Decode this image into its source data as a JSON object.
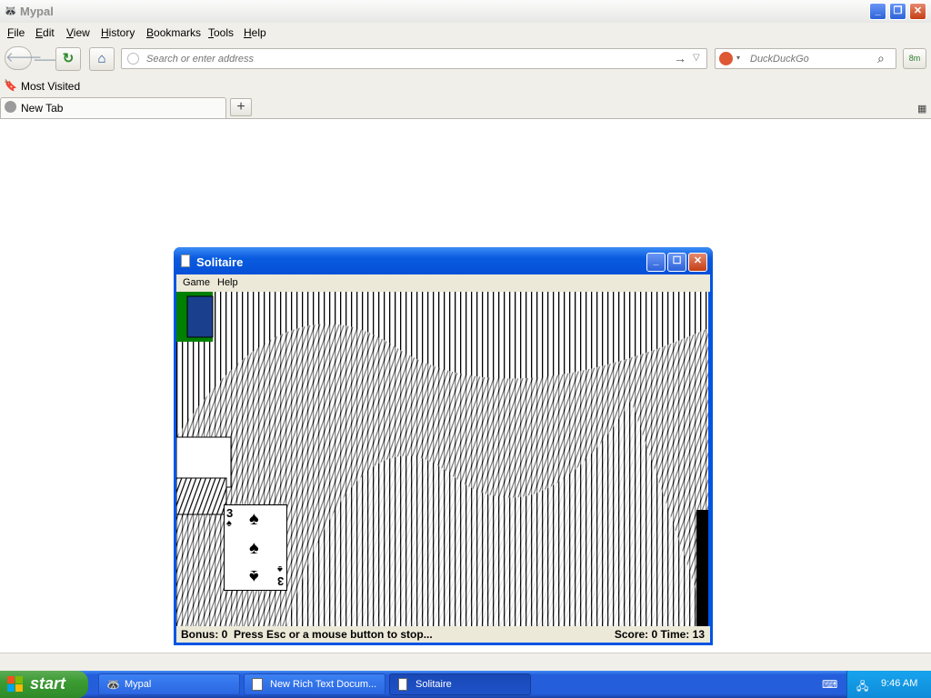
{
  "browser": {
    "title": "Mypal",
    "menu": [
      "File",
      "Edit",
      "View",
      "History",
      "Bookmarks",
      "Tools",
      "Help"
    ],
    "menu_access": [
      "F",
      "E",
      "V",
      "H",
      "B",
      "T",
      "H"
    ],
    "url_placeholder": "Search or enter address",
    "search_engine": "DuckDuckGo",
    "bookmarks_toolbar_item": "Most Visited",
    "tab_label": "New Tab",
    "new_tab_label": "+"
  },
  "solitaire": {
    "title": "Solitaire",
    "menu": [
      "Game",
      "Help"
    ],
    "status_left": "Bonus: 0  Press Esc or a mouse button to stop...",
    "status_right": "Score: 0 Time: 13",
    "card_rank": "3",
    "card_suit": "♠"
  },
  "taskbar": {
    "start_label": "start",
    "items": [
      {
        "label": "Mypal",
        "active": false
      },
      {
        "label": "New Rich Text Docum...",
        "active": false
      },
      {
        "label": "Solitaire",
        "active": true
      }
    ],
    "clock": "9:46 AM"
  },
  "icons": {
    "back": "back-arrow-icon",
    "forward": "forward-arrow-icon",
    "reload": "reload-icon",
    "home": "home-icon",
    "search": "magnifier-icon"
  },
  "colors": {
    "xp_blue": "#0054e3",
    "start_green": "#3c9b33",
    "felt_green": "#008000"
  }
}
